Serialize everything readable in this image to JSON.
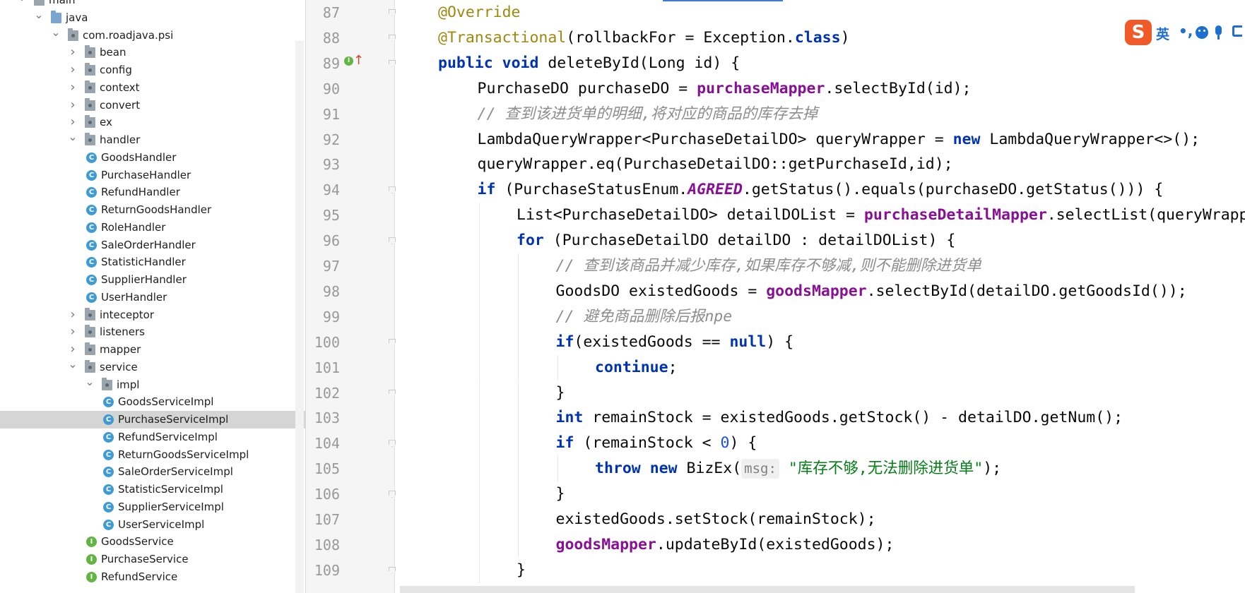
{
  "project_tree": {
    "items": [
      {
        "label": "main",
        "depth": 1,
        "kind": "folder-gray",
        "arrow": "down"
      },
      {
        "label": "java",
        "depth": 2,
        "kind": "folder-blue",
        "arrow": "down"
      },
      {
        "label": "com.roadjava.psi",
        "depth": 3,
        "kind": "package",
        "arrow": "down"
      },
      {
        "label": "bean",
        "depth": 4,
        "kind": "package",
        "arrow": "right"
      },
      {
        "label": "config",
        "depth": 4,
        "kind": "package",
        "arrow": "right"
      },
      {
        "label": "context",
        "depth": 4,
        "kind": "package",
        "arrow": "right"
      },
      {
        "label": "convert",
        "depth": 4,
        "kind": "package",
        "arrow": "right"
      },
      {
        "label": "ex",
        "depth": 4,
        "kind": "package",
        "arrow": "right"
      },
      {
        "label": "handler",
        "depth": 4,
        "kind": "package",
        "arrow": "down"
      },
      {
        "label": "GoodsHandler",
        "depth": 5,
        "kind": "class"
      },
      {
        "label": "PurchaseHandler",
        "depth": 5,
        "kind": "class"
      },
      {
        "label": "RefundHandler",
        "depth": 5,
        "kind": "class"
      },
      {
        "label": "ReturnGoodsHandler",
        "depth": 5,
        "kind": "class"
      },
      {
        "label": "RoleHandler",
        "depth": 5,
        "kind": "class"
      },
      {
        "label": "SaleOrderHandler",
        "depth": 5,
        "kind": "class"
      },
      {
        "label": "StatisticHandler",
        "depth": 5,
        "kind": "class"
      },
      {
        "label": "SupplierHandler",
        "depth": 5,
        "kind": "class"
      },
      {
        "label": "UserHandler",
        "depth": 5,
        "kind": "class"
      },
      {
        "label": "inteceptor",
        "depth": 4,
        "kind": "package",
        "arrow": "right"
      },
      {
        "label": "listeners",
        "depth": 4,
        "kind": "package",
        "arrow": "right"
      },
      {
        "label": "mapper",
        "depth": 4,
        "kind": "package",
        "arrow": "right"
      },
      {
        "label": "service",
        "depth": 4,
        "kind": "package",
        "arrow": "down"
      },
      {
        "label": "impl",
        "depth": 5,
        "kind": "package",
        "arrow": "down"
      },
      {
        "label": "GoodsServiceImpl",
        "depth": 6,
        "kind": "class"
      },
      {
        "label": "PurchaseServiceImpl",
        "depth": 6,
        "kind": "class",
        "selected": true
      },
      {
        "label": "RefundServiceImpl",
        "depth": 6,
        "kind": "class"
      },
      {
        "label": "ReturnGoodsServiceImpl",
        "depth": 6,
        "kind": "class"
      },
      {
        "label": "SaleOrderServiceImpl",
        "depth": 6,
        "kind": "class"
      },
      {
        "label": "StatisticServiceImpl",
        "depth": 6,
        "kind": "class"
      },
      {
        "label": "SupplierServiceImpl",
        "depth": 6,
        "kind": "class"
      },
      {
        "label": "UserServiceImpl",
        "depth": 6,
        "kind": "class"
      },
      {
        "label": "GoodsService",
        "depth": 5,
        "kind": "interface"
      },
      {
        "label": "PurchaseService",
        "depth": 5,
        "kind": "interface"
      },
      {
        "label": "RefundService",
        "depth": 5,
        "kind": "interface"
      }
    ],
    "class_badge": "C",
    "interface_badge": "I"
  },
  "editor": {
    "lines": [
      {
        "num": "87",
        "indent": 0,
        "fold": true,
        "tokens": [
          {
            "t": "@Override",
            "c": "ann"
          }
        ]
      },
      {
        "num": "88",
        "indent": 0,
        "fold": true,
        "tokens": [
          {
            "t": "@Transactional",
            "c": "ann"
          },
          {
            "t": "(rollbackFor = Exception."
          },
          {
            "t": "class",
            "c": "kw"
          },
          {
            "t": ")"
          }
        ]
      },
      {
        "num": "89",
        "indent": 0,
        "fold": true,
        "tokens": [
          {
            "t": "public",
            "c": "kw"
          },
          {
            "t": " "
          },
          {
            "t": "void",
            "c": "kw"
          },
          {
            "t": " deleteById(Long id) {"
          }
        ]
      },
      {
        "num": "90",
        "indent": 1,
        "tokens": [
          {
            "t": "PurchaseDO purchaseDO = "
          },
          {
            "t": "purchaseMapper",
            "c": "fld"
          },
          {
            "t": ".selectById(id);"
          }
        ]
      },
      {
        "num": "91",
        "indent": 1,
        "tokens": [
          {
            "t": "// 查到该进货单的明细,将对应的商品的库存去掉",
            "c": "cmt"
          }
        ]
      },
      {
        "num": "92",
        "indent": 1,
        "tokens": [
          {
            "t": "LambdaQueryWrapper<PurchaseDetailDO> queryWrapper = "
          },
          {
            "t": "new",
            "c": "kw"
          },
          {
            "t": " LambdaQueryWrapper<>();"
          }
        ]
      },
      {
        "num": "93",
        "indent": 1,
        "tokens": [
          {
            "t": "queryWrapper.eq(PurchaseDetailDO::getPurchaseId,id);"
          }
        ]
      },
      {
        "num": "94",
        "indent": 1,
        "fold": true,
        "tokens": [
          {
            "t": "if",
            "c": "kw"
          },
          {
            "t": " (PurchaseStatusEnum."
          },
          {
            "t": "AGREED",
            "c": "enm"
          },
          {
            "t": ".getStatus().equals(purchaseDO.getStatus())) {"
          }
        ]
      },
      {
        "num": "95",
        "indent": 2,
        "tokens": [
          {
            "t": "List<PurchaseDetailDO> detailDOList = "
          },
          {
            "t": "purchaseDetailMapper",
            "c": "fld"
          },
          {
            "t": ".selectList(queryWrapper);"
          }
        ]
      },
      {
        "num": "96",
        "indent": 2,
        "fold": true,
        "tokens": [
          {
            "t": "for",
            "c": "kw"
          },
          {
            "t": " (PurchaseDetailDO detailDO : detailDOList) {"
          }
        ]
      },
      {
        "num": "97",
        "indent": 3,
        "tokens": [
          {
            "t": "// 查到该商品并减少库存,如果库存不够减,则不能删除进货单",
            "c": "cmt"
          }
        ]
      },
      {
        "num": "98",
        "indent": 3,
        "tokens": [
          {
            "t": "GoodsDO existedGoods = "
          },
          {
            "t": "goodsMapper",
            "c": "fld"
          },
          {
            "t": ".selectById(detailDO.getGoodsId());"
          }
        ]
      },
      {
        "num": "99",
        "indent": 3,
        "tokens": [
          {
            "t": "// 避免商品删除后报npe",
            "c": "cmt"
          }
        ]
      },
      {
        "num": "100",
        "indent": 3,
        "fold": true,
        "tokens": [
          {
            "t": "if",
            "c": "kw"
          },
          {
            "t": "(existedGoods == "
          },
          {
            "t": "null",
            "c": "kw"
          },
          {
            "t": ") {"
          }
        ]
      },
      {
        "num": "101",
        "indent": 4,
        "tokens": [
          {
            "t": "continue",
            "c": "kw"
          },
          {
            "t": ";"
          }
        ]
      },
      {
        "num": "102",
        "indent": 3,
        "fold": true,
        "tokens": [
          {
            "t": "}"
          }
        ]
      },
      {
        "num": "103",
        "indent": 3,
        "tokens": [
          {
            "t": "int",
            "c": "kw"
          },
          {
            "t": " remainStock = existedGoods.getStock() - detailDO.getNum();"
          }
        ]
      },
      {
        "num": "104",
        "indent": 3,
        "fold": true,
        "tokens": [
          {
            "t": "if",
            "c": "kw"
          },
          {
            "t": " (remainStock < "
          },
          {
            "t": "0",
            "c": "num"
          },
          {
            "t": ") {"
          }
        ]
      },
      {
        "num": "105",
        "indent": 4,
        "tokens": [
          {
            "t": "throw",
            "c": "kw"
          },
          {
            "t": " "
          },
          {
            "t": "new",
            "c": "kw"
          },
          {
            "t": " BizEx("
          },
          {
            "t": "msg:",
            "c": "hint"
          },
          {
            "t": " "
          },
          {
            "t": "\"库存不够,无法删除进货单\"",
            "c": "str"
          },
          {
            "t": ");"
          }
        ]
      },
      {
        "num": "106",
        "indent": 3,
        "fold": true,
        "tokens": [
          {
            "t": "}"
          }
        ]
      },
      {
        "num": "107",
        "indent": 3,
        "tokens": [
          {
            "t": "existedGoods.setStock(remainStock);"
          }
        ]
      },
      {
        "num": "108",
        "indent": 3,
        "tokens": [
          {
            "t": "goodsMapper",
            "c": "fld"
          },
          {
            "t": ".updateById(existedGoods);"
          }
        ]
      },
      {
        "num": "109",
        "indent": 2,
        "fold": true,
        "tokens": [
          {
            "t": "}"
          }
        ]
      }
    ]
  },
  "gutter_markers": {
    "implements_badge": "I",
    "override_arrow": "↑"
  },
  "ime_toolbar": {
    "logo": "S",
    "language": "英",
    "punct": "•,"
  },
  "colors": {
    "keyword": "#0033b3",
    "annotation": "#9e880d",
    "field": "#871094",
    "comment": "#8c8c8c",
    "string": "#067d17",
    "number": "#1750eb",
    "selection": "#d5d5d5",
    "ime_logo": "#f05a28",
    "ime_icons": "#1f6fd1"
  }
}
